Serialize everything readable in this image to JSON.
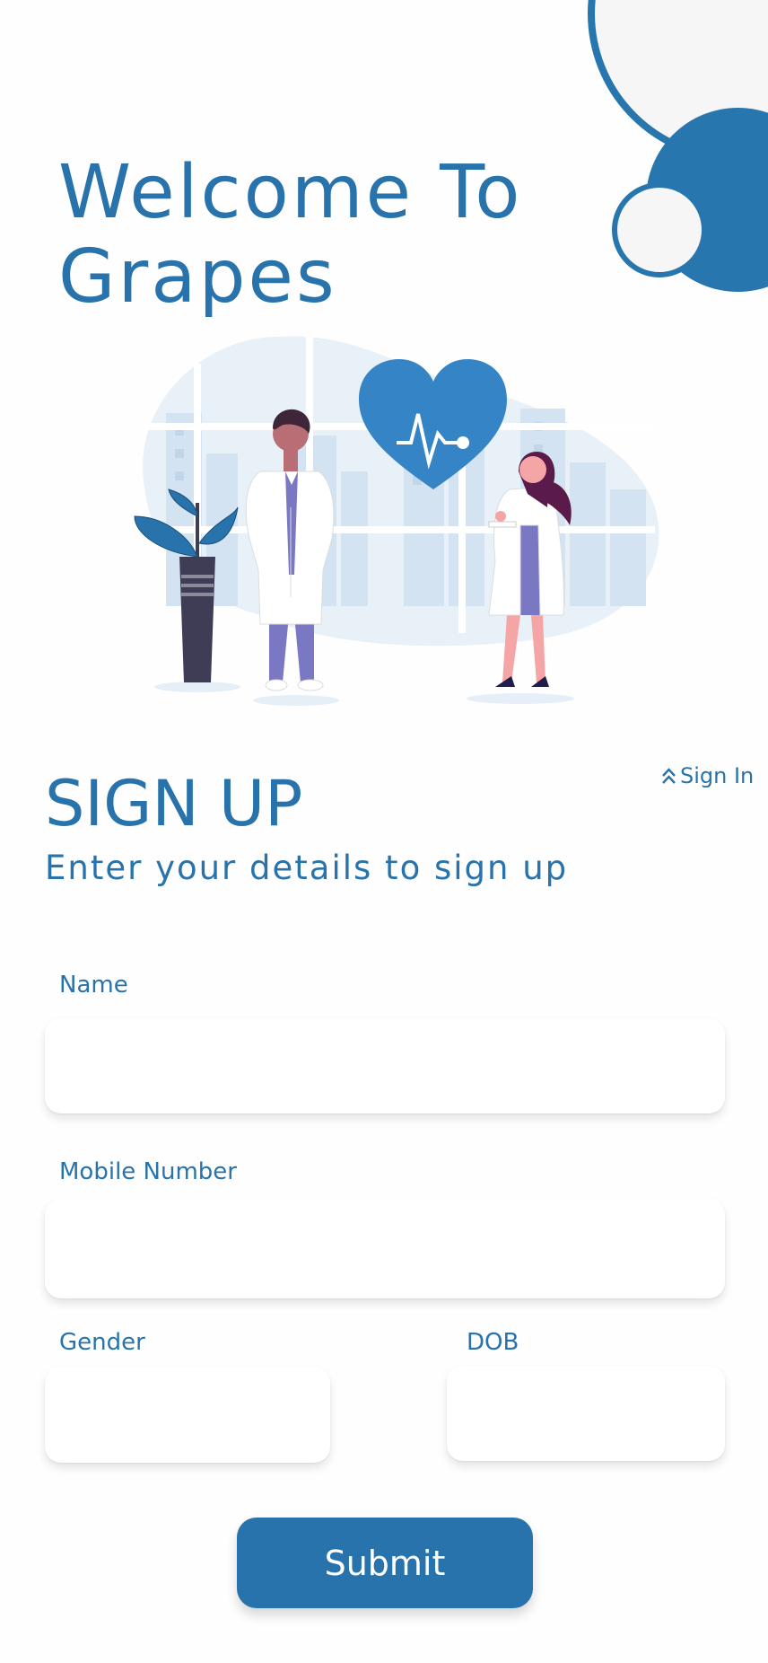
{
  "header": {
    "welcome_line1": "Welcome To",
    "welcome_line2": "Grapes"
  },
  "illustration": {
    "name": "doctors-with-heart-illustration"
  },
  "signup": {
    "title": "SIGN UP",
    "subtitle": "Enter your details to sign up",
    "signin_link": "Sign In",
    "signin_icon": "double-chevron-up-icon"
  },
  "form": {
    "name_label": "Name",
    "name_value": "",
    "mobile_label": "Mobile Number",
    "mobile_value": "",
    "gender_label": "Gender",
    "gender_value": "",
    "dob_label": "DOB",
    "dob_value": "",
    "submit_label": "Submit"
  },
  "colors": {
    "primary": "#2873ab",
    "background": "#fefefe",
    "heart": "#3584c5",
    "scrubs": "#7a78c2"
  }
}
